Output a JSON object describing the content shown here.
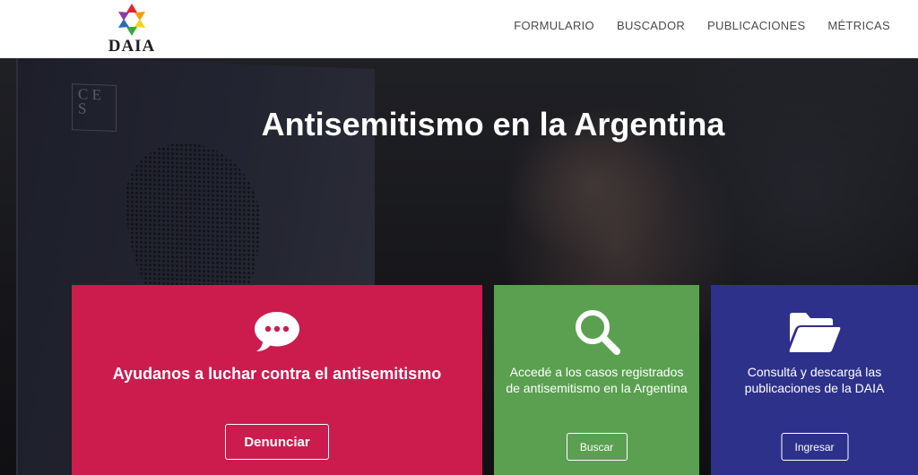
{
  "header": {
    "logo_text": "DAIA",
    "nav": [
      {
        "label": "FORMULARIO"
      },
      {
        "label": "BUSCADOR"
      },
      {
        "label": "PUBLICACIONES"
      },
      {
        "label": "MÉTRICAS"
      }
    ]
  },
  "hero": {
    "title": "Antisemitismo en la Argentina",
    "background_book_text": "C E S"
  },
  "cards": [
    {
      "text": "Ayudanos a luchar contra el antisemitismo",
      "button": "Denunciar",
      "icon": "chat-bubble-icon",
      "color": "#cc1c4e"
    },
    {
      "text": "Accedé a los casos registrados de antisemitismo en la Argentina",
      "button": "Buscar",
      "icon": "search-icon",
      "color": "#5aa050"
    },
    {
      "text": "Consultá y descargá las publicaciones de la DAIA",
      "button": "Ingresar",
      "icon": "folder-open-icon",
      "color": "#2e318a"
    }
  ]
}
